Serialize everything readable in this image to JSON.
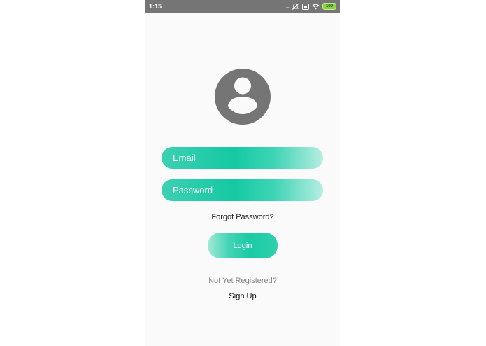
{
  "status_bar": {
    "time": "1:15",
    "more_indicator": "...",
    "battery_level": "100",
    "icons": [
      "more-dots-icon",
      "muted-icon",
      "sim-icon",
      "wifi-icon",
      "battery-icon"
    ]
  },
  "avatar": {
    "icon": "account-circle-icon",
    "color": "#757575"
  },
  "form": {
    "email_placeholder": "Email",
    "password_placeholder": "Password",
    "forgot_password": "Forgot Password?",
    "login_label": "Login",
    "not_registered": "Not Yet Registered?",
    "sign_up": "Sign Up"
  },
  "colors": {
    "accent": "#14c9a3",
    "accent_light": "#b6eee1",
    "status_bar": "#757575",
    "background": "#fafafa"
  }
}
